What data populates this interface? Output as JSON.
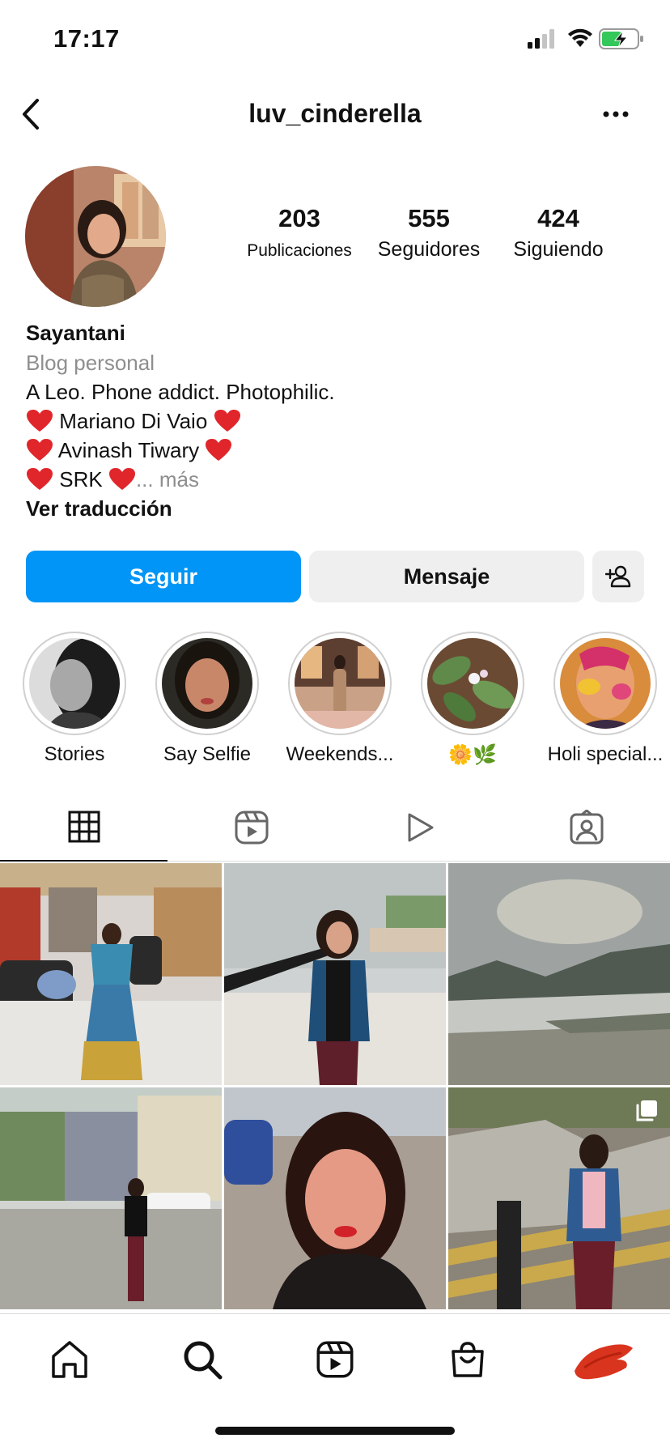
{
  "status_bar": {
    "time": "17:17"
  },
  "nav": {
    "username": "luv_cinderella"
  },
  "stats": [
    {
      "value": "203",
      "label": "Publicaciones"
    },
    {
      "value": "555",
      "label": "Seguidores"
    },
    {
      "value": "424",
      "label": "Siguiendo"
    }
  ],
  "bio": {
    "name": "Sayantani",
    "category": "Blog personal",
    "line1": "A Leo. Phone addict. Photophilic.",
    "line2": "Mariano Di Vaio",
    "line3": "Avinash Tiwary",
    "line4": "SRK",
    "more": "... más",
    "translate": "Ver traducción"
  },
  "buttons": {
    "follow": "Seguir",
    "message": "Mensaje"
  },
  "highlights": [
    {
      "label": "Stories"
    },
    {
      "label": "Say Selfie"
    },
    {
      "label": "Weekends..."
    },
    {
      "label": "🌼🌿"
    },
    {
      "label": "Holi special..."
    }
  ],
  "tabs": [
    "posts-grid",
    "reels",
    "videos",
    "tagged"
  ],
  "colors": {
    "accent": "#0095f6",
    "button_gray": "#efefef",
    "muted_text": "#8e8e8e",
    "heart": "#e0262b"
  }
}
